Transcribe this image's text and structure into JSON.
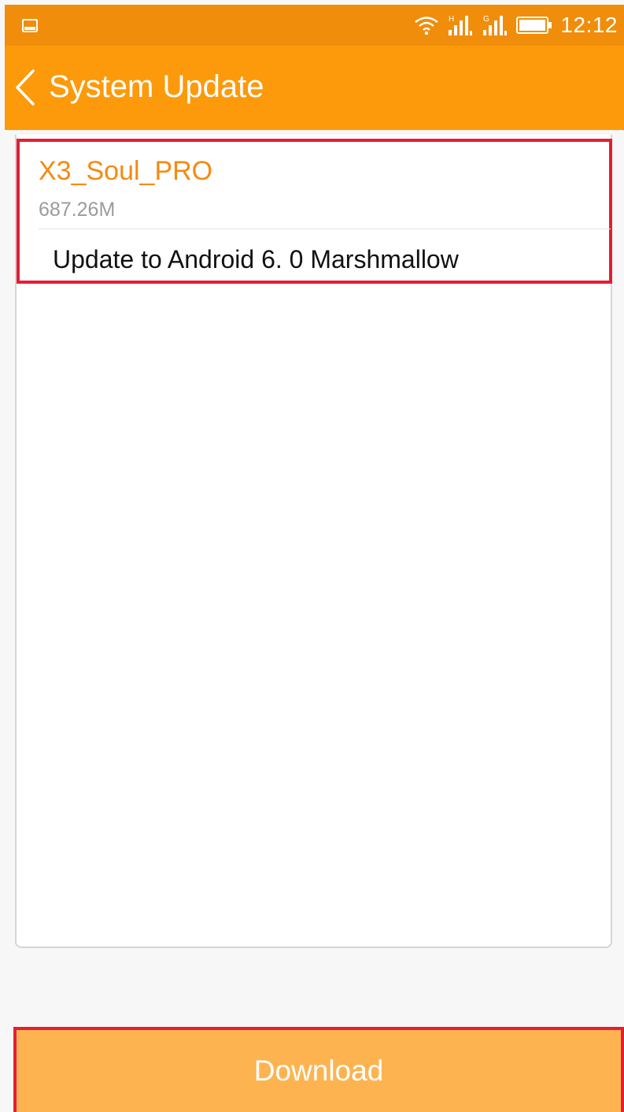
{
  "status_bar": {
    "time": "12:12",
    "icons": [
      "image-notification-icon",
      "wifi-icon",
      "signal-sim1-icon",
      "signal-sim2-icon",
      "battery-icon"
    ],
    "sim1_network": "H",
    "sim2_network": "G"
  },
  "action_bar": {
    "title": "System Update",
    "back_icon": "chevron-left-icon"
  },
  "update": {
    "package_name": "X3_Soul_PRO",
    "size": "687.26M",
    "description": "Update to Android 6. 0 Marshmallow"
  },
  "footer": {
    "download_label": "Download"
  },
  "colors": {
    "status_bar": "#f08d0a",
    "action_bar": "#fc9a0b",
    "accent_text": "#f58a10",
    "download_button": "#fdb450",
    "highlight_border": "#e51d34"
  }
}
